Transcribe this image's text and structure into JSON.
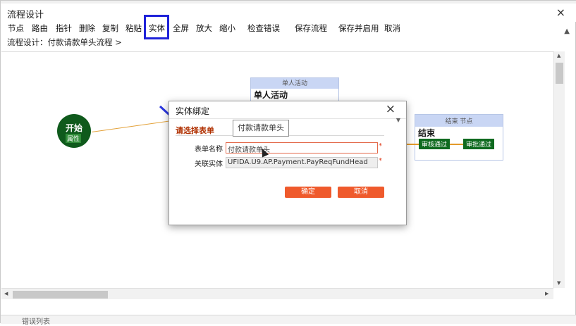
{
  "window": {
    "title": "流程设计",
    "close_icon": "×"
  },
  "toolbar": {
    "items": [
      "节点",
      "路由",
      "指针",
      "删除",
      "复制",
      "粘贴",
      "实体",
      "全屏",
      "放大",
      "缩小",
      "检查错误",
      "保存流程",
      "保存并启用",
      "取消"
    ],
    "highlighted": "实体"
  },
  "breadcrumb": "流程设计：付款请款单头流程 >",
  "canvas": {
    "start_node": {
      "label": "开始",
      "attr": "属性"
    },
    "activity_node": {
      "header": "单人活动",
      "title": "单人活动"
    },
    "end_node": {
      "header": "结束 节点",
      "title": "结束",
      "buttons": [
        "审核通过",
        "审批通过"
      ]
    }
  },
  "dialog": {
    "title": "实体绑定",
    "section": "请选择表单",
    "tooltip": "付款请款单头",
    "form_name_label": "表单名称",
    "form_name_value": "付款请款单头",
    "entity_label": "关联实体",
    "entity_value": "UFIDA.U9.AP.Payment.PayReqFundHead",
    "ok": "确定",
    "cancel": "取消"
  },
  "status": {
    "text": "错误列表"
  },
  "colors": {
    "highlight": "#1f22d9",
    "start_node": "#0f5a1c",
    "button": "#ef5a2c",
    "node_header": "#c9d6f4"
  }
}
